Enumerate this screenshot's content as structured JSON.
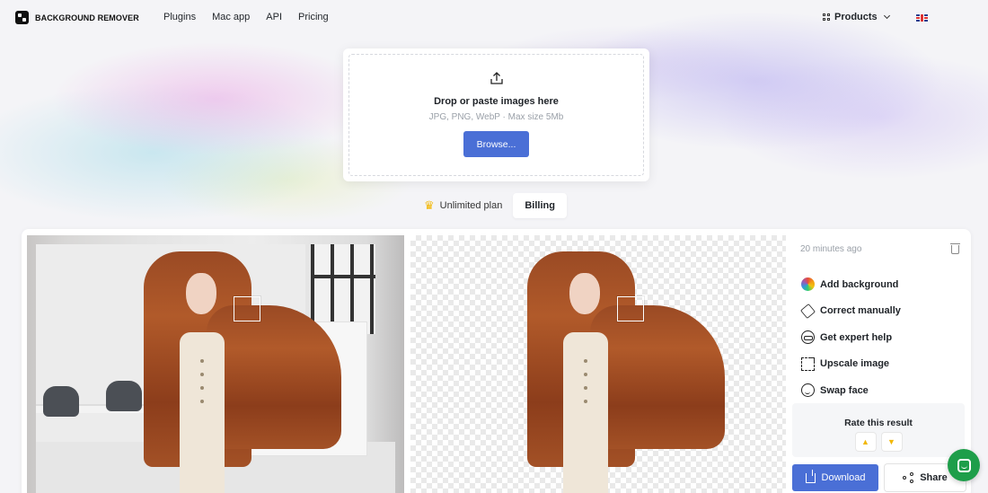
{
  "header": {
    "logo_text": "BACKGROUND REMOVER",
    "nav": [
      "Plugins",
      "Mac app",
      "API",
      "Pricing"
    ],
    "products_label": "Products",
    "language_flag": "uk-flag-icon"
  },
  "upload": {
    "title": "Drop or paste images here",
    "subtitle": "JPG, PNG, WebP · Max size 5Mb",
    "browse_label": "Browse...",
    "icon": "upload-icon"
  },
  "plan": {
    "crown_icon": "crown-icon",
    "plan_label": "Unlimited plan",
    "billing_label": "Billing"
  },
  "result": {
    "timestamp": "20 minutes ago",
    "actions": [
      {
        "label": "Add background",
        "icon": "color-wheel-icon"
      },
      {
        "label": "Correct manually",
        "icon": "eraser-icon"
      },
      {
        "label": "Get expert help",
        "icon": "expert-icon"
      },
      {
        "label": "Upscale image",
        "icon": "upscale-icon"
      },
      {
        "label": "Swap face",
        "icon": "face-icon"
      }
    ],
    "rate_title": "Rate this result",
    "download_label": "Download",
    "share_label": "Share"
  },
  "colors": {
    "accent": "#4a6fd6",
    "chat": "#1e9e4a"
  }
}
